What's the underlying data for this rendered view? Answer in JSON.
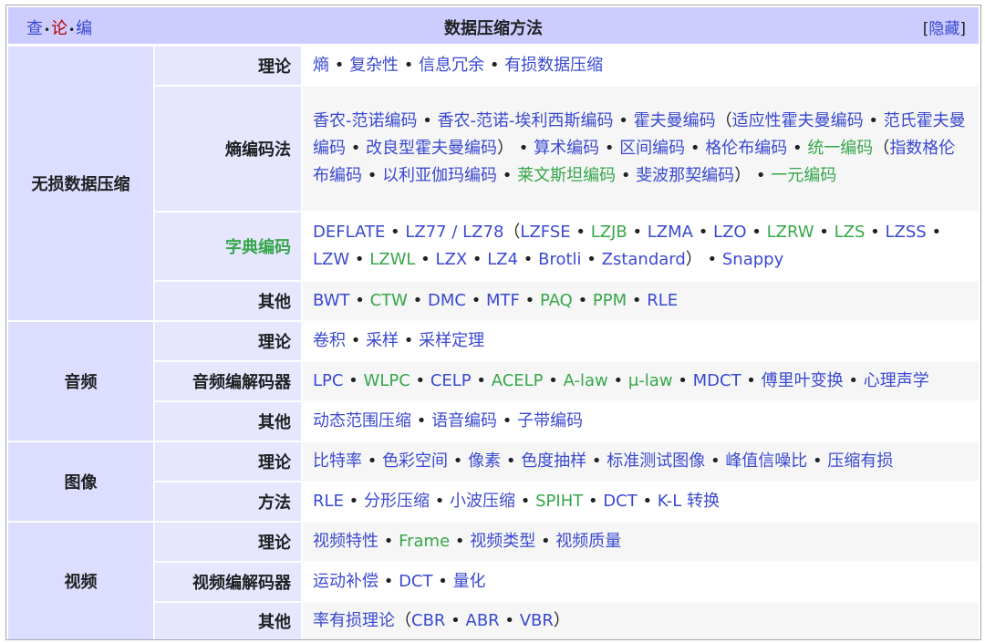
{
  "navbox": {
    "vte": {
      "view": "查",
      "talk": "论",
      "edit": "编"
    },
    "title": "数据压缩方法",
    "hide": {
      "open": "[",
      "label": "隐藏",
      "close": "]"
    }
  },
  "groups": {
    "lossless": "无损数据压缩",
    "audio": "音频",
    "image": "图像",
    "video": "视频"
  },
  "labels": {
    "r0": "理论",
    "r1": "熵编码法",
    "r2": "字典编码",
    "r3": "其他",
    "r4": "理论",
    "r5": "音频编解码器",
    "r6": "其他",
    "r7": "理论",
    "r8": "方法",
    "r9": "理论",
    "r10": "视频编解码器",
    "r11": "其他"
  },
  "rows": {
    "r0": [
      "熵",
      "复杂性",
      "信息冗余",
      "有损数据压缩"
    ],
    "r1": {
      "a": "香农-范诺编码",
      "b": "香农-范诺-埃利西斯编码",
      "c": "霍夫曼编码",
      "c_open": "（",
      "c1": "适应性霍夫曼编码",
      "c2": "范氏霍夫曼编码",
      "c3": "改良型霍夫曼编码",
      "c_close": "）",
      "d": "算术编码",
      "e": "区间编码",
      "f": "格伦布编码",
      "g": "统一编码",
      "g_open": "（",
      "g1": "指数格伦布编码",
      "g2": "以利亚伽玛编码",
      "g3": "莱文斯坦编码",
      "g4": "斐波那契编码",
      "g_close": "）",
      "h": "一元编码"
    },
    "r2": {
      "a": "DEFLATE",
      "b": "LZ77 / LZ78",
      "open": "（",
      "c1": "LZFSE",
      "c2": "LZJB",
      "c3": "LZMA",
      "c4": "LZO",
      "c5": "LZRW",
      "c6": "LZS",
      "c7": "LZSS",
      "c8": "LZW",
      "c9": "LZWL",
      "c10": "LZX",
      "c11": "LZ4",
      "c12": "Brotli",
      "c13": "Zstandard",
      "close": "）",
      "d": "Snappy"
    },
    "r3": [
      "BWT",
      "CTW",
      "DMC",
      "MTF",
      "PAQ",
      "PPM",
      "RLE"
    ],
    "r4": [
      "卷积",
      "采样",
      "采样定理"
    ],
    "r5": [
      "LPC",
      "WLPC",
      "CELP",
      "ACELP",
      "A-law",
      "μ-law",
      "MDCT",
      "傅里叶变换",
      "心理声学"
    ],
    "r6": [
      "动态范围压缩",
      "语音编码",
      "子带编码"
    ],
    "r7": [
      "比特率",
      "色彩空间",
      "像素",
      "色度抽样",
      "标准测试图像",
      "峰值信噪比",
      "压缩有损"
    ],
    "r8": [
      "RLE",
      "分形压缩",
      "小波压缩",
      "SPIHT",
      "DCT",
      "K-L 转换"
    ],
    "r9": [
      "视频特性",
      "Frame",
      "视频类型",
      "视频质量"
    ],
    "r10": [
      "运动补偿",
      "DCT",
      "量化"
    ],
    "r11": {
      "a": "率有损理论",
      "open": "（",
      "b1": "CBR",
      "b2": "ABR",
      "b3": "VBR",
      "close": "）"
    }
  },
  "separator": " • ",
  "colors": {
    "link": "#3a49d0",
    "new_link": "#36a64a",
    "red_link": "#ba0000",
    "title_bg": "#ccccff",
    "group_bg": "#ddddff"
  }
}
